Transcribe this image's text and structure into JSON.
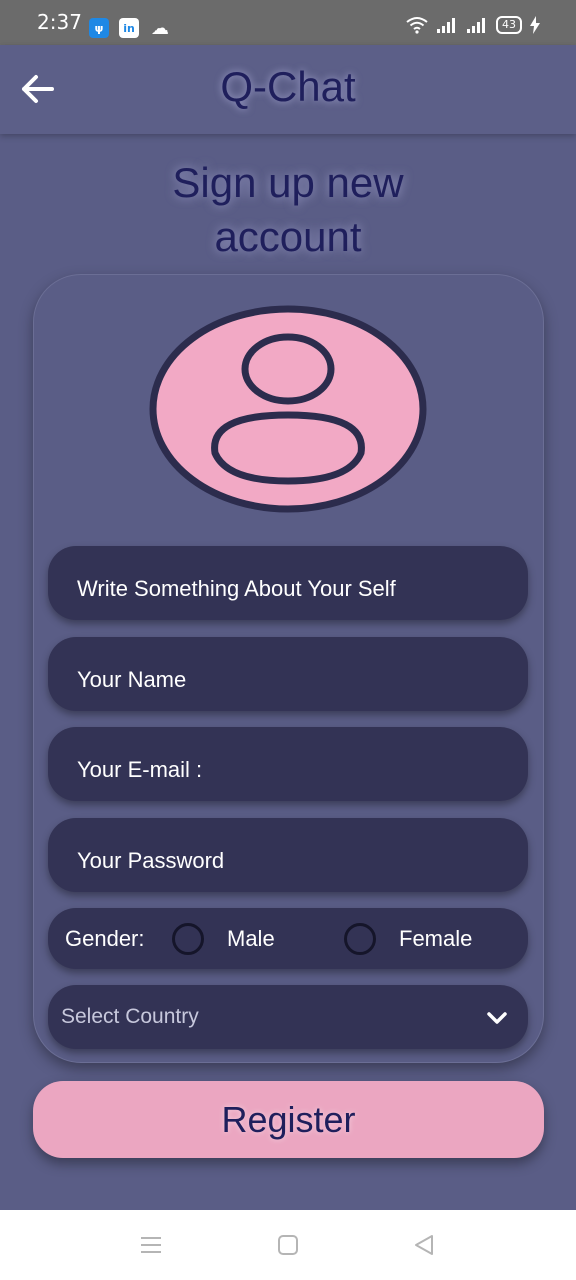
{
  "status_bar": {
    "time": "2:37",
    "battery": "43",
    "left_icons": [
      "usb-icon",
      "linkedin-icon",
      "cloud-icon"
    ],
    "right_icons": [
      "wifi-icon",
      "signal-icon",
      "signal-icon",
      "battery-icon",
      "charging-icon"
    ]
  },
  "app_bar": {
    "title": "Q-Chat",
    "back_icon": "arrow-left-icon"
  },
  "heading": {
    "line1": "Sign up new",
    "line2": "account"
  },
  "avatar": {
    "icon": "user-avatar-icon",
    "fill_color": "#f2a9c5",
    "stroke_color": "#2c2c4d"
  },
  "fields": {
    "about": "Write Something About Your Self",
    "name": "Your Name",
    "email": "Your E-mail :",
    "password": "Your Password"
  },
  "gender": {
    "label": "Gender:",
    "male": "Male",
    "female": "Female"
  },
  "country": {
    "placeholder": "Select Country",
    "icon": "chevron-down-icon"
  },
  "register": {
    "label": "Register"
  },
  "colors": {
    "background": "#5a5d86",
    "field": "#333355",
    "accent_pink": "#eba6c1",
    "title_text": "#1f1f5c"
  },
  "nav_bar": {
    "icons": [
      "menu-icon",
      "home-icon",
      "back-icon"
    ]
  }
}
